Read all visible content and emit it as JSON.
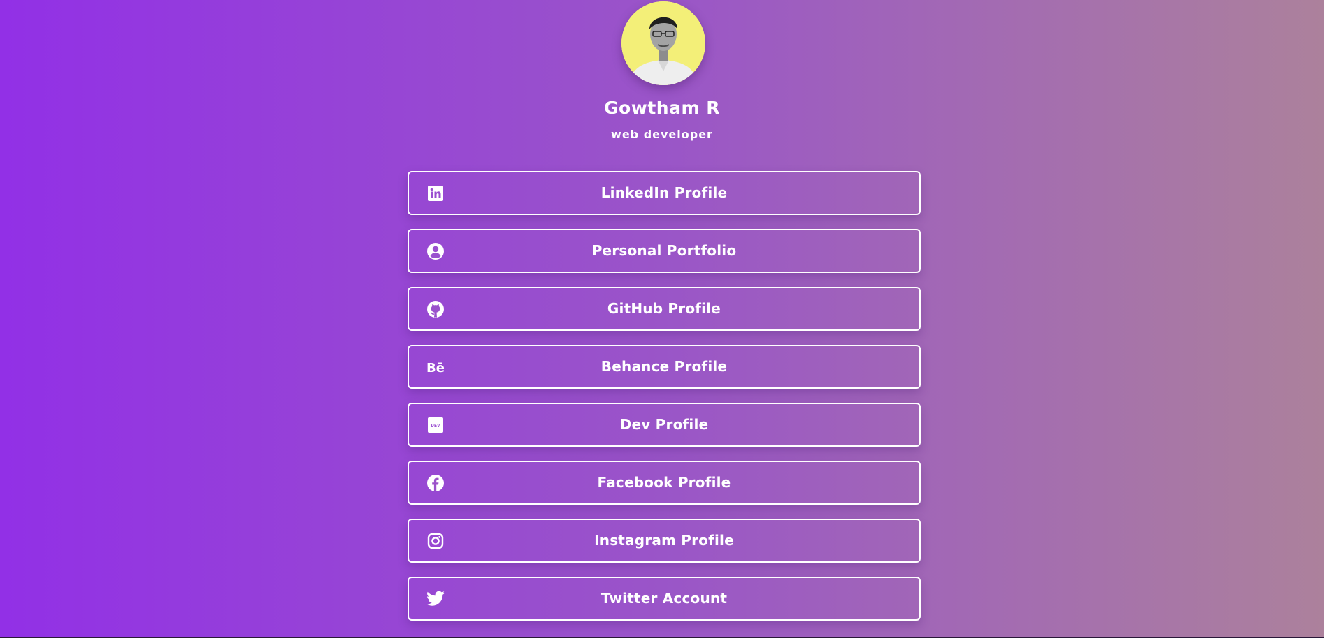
{
  "profile": {
    "name": "Gowtham R",
    "role": "web developer"
  },
  "links": [
    {
      "label": "LinkedIn Profile",
      "icon": "linkedin-icon"
    },
    {
      "label": "Personal Portfolio",
      "icon": "user-circle-icon"
    },
    {
      "label": "GitHub Profile",
      "icon": "github-icon"
    },
    {
      "label": "Behance Profile",
      "icon": "behance-icon"
    },
    {
      "label": "Dev Profile",
      "icon": "dev-icon"
    },
    {
      "label": "Facebook Profile",
      "icon": "facebook-icon"
    },
    {
      "label": "Instagram Profile",
      "icon": "instagram-icon"
    },
    {
      "label": "Twitter Account",
      "icon": "twitter-icon"
    }
  ],
  "colors": {
    "gradient_start": "#9230e6",
    "gradient_mid": "#9a55c8",
    "gradient_end": "#ac819c",
    "avatar_background": "#f3ef78",
    "text": "#ffffff"
  }
}
